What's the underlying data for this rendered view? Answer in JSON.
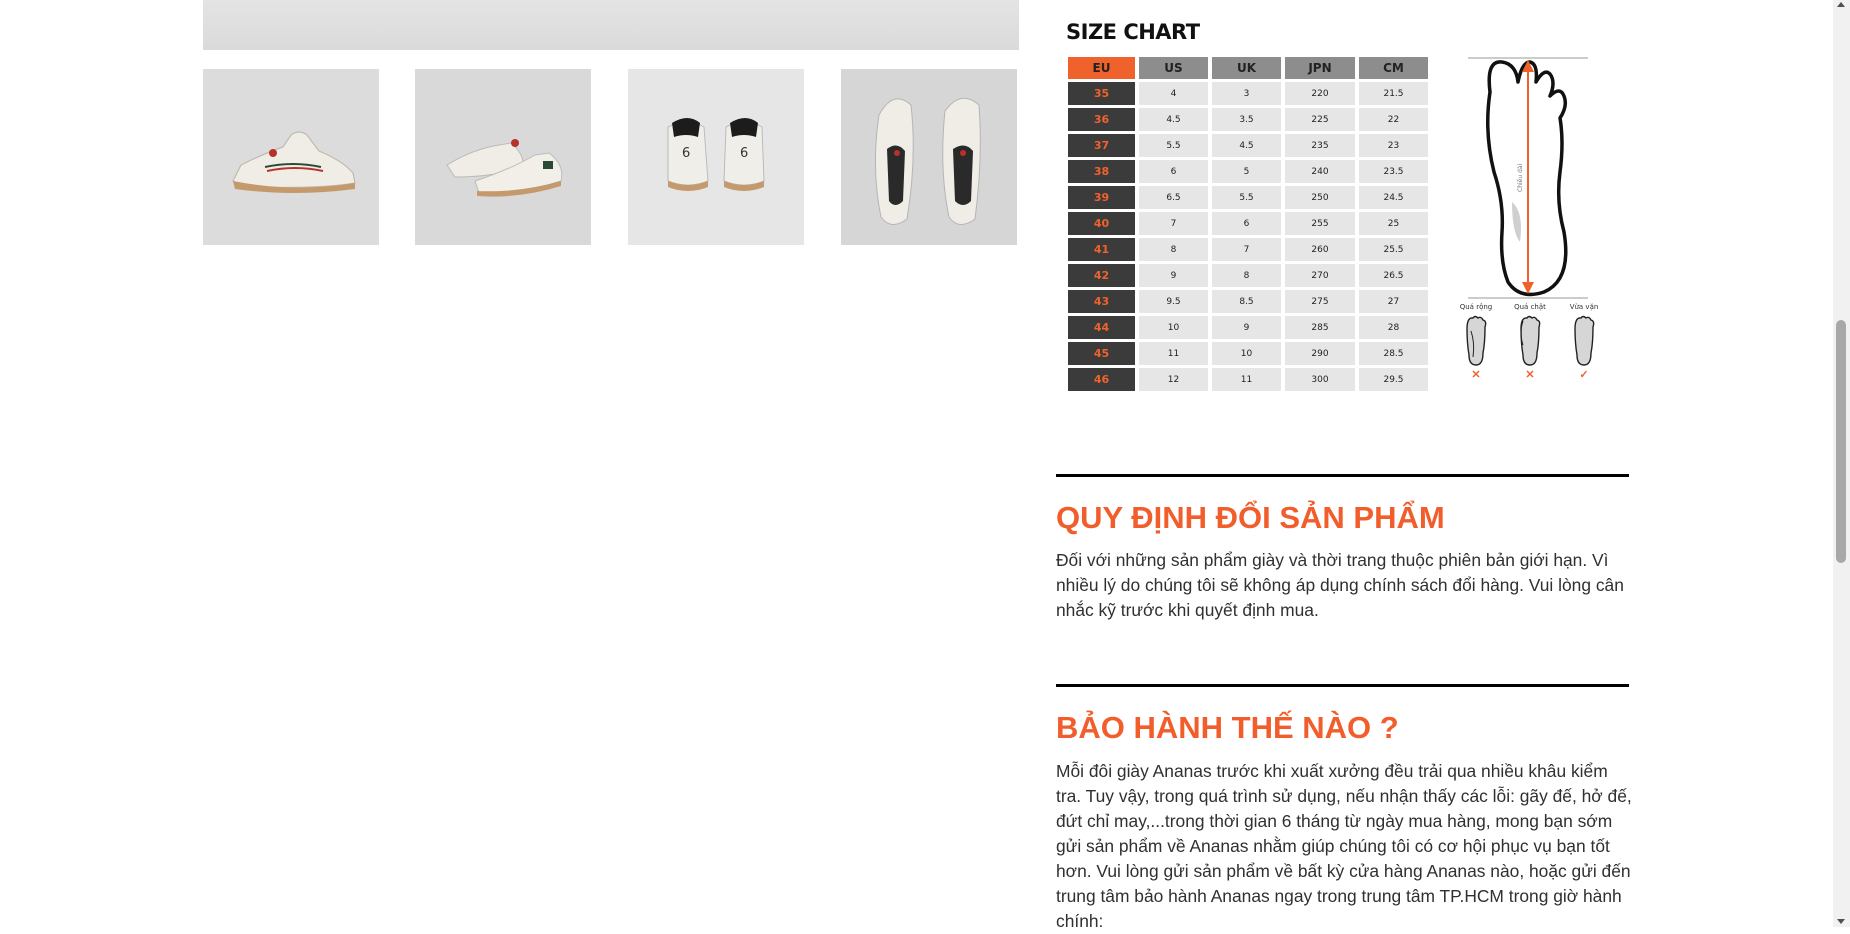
{
  "gallery": {
    "thumbnails": [
      {
        "name": "thumb-side-view",
        "alt_icon": "shoe-side-icon"
      },
      {
        "name": "thumb-angle-view",
        "alt_icon": "shoe-pair-icon"
      },
      {
        "name": "thumb-back-view",
        "alt_icon": "shoe-back-icon"
      },
      {
        "name": "thumb-top-view",
        "alt_icon": "shoe-top-icon"
      }
    ]
  },
  "size_chart": {
    "title": "SIZE CHART",
    "headers": [
      "EU",
      "US",
      "UK",
      "JPN",
      "CM"
    ],
    "rows": [
      [
        "35",
        "4",
        "3",
        "220",
        "21.5"
      ],
      [
        "36",
        "4.5",
        "3.5",
        "225",
        "22"
      ],
      [
        "37",
        "5.5",
        "4.5",
        "235",
        "23"
      ],
      [
        "38",
        "6",
        "5",
        "240",
        "23.5"
      ],
      [
        "39",
        "6.5",
        "5.5",
        "250",
        "24.5"
      ],
      [
        "40",
        "7",
        "6",
        "255",
        "25"
      ],
      [
        "41",
        "8",
        "7",
        "260",
        "25.5"
      ],
      [
        "42",
        "9",
        "8",
        "270",
        "26.5"
      ],
      [
        "43",
        "9.5",
        "8.5",
        "275",
        "27"
      ],
      [
        "44",
        "10",
        "9",
        "285",
        "28"
      ],
      [
        "45",
        "11",
        "10",
        "290",
        "28.5"
      ],
      [
        "46",
        "12",
        "11",
        "300",
        "29.5"
      ]
    ],
    "foot_measure_label": "Chiều dài",
    "fit_labels": [
      "Quá rộng",
      "Quá chật",
      "Vừa vặn"
    ],
    "fit_marks": [
      "✕",
      "✕",
      "✓"
    ],
    "accent_color": "#f0622c"
  },
  "sections": {
    "exchange": {
      "title": "QUY ĐỊNH ĐỔI SẢN PHẨM",
      "body": "Đối với những sản phẩm giày và thời trang thuộc phiên bản giới hạn. Vì nhiều lý do chúng tôi sẽ không áp dụng chính sách đổi hàng. Vui lòng cân nhắc kỹ trước khi quyết định mua."
    },
    "warranty": {
      "title": "BẢO HÀNH THẾ NÀO ?",
      "body": "Mỗi đôi giày Ananas trước khi xuất xưởng đều trải qua nhiều khâu kiểm tra. Tuy vậy, trong quá trình sử dụng, nếu nhận thấy các lỗi: gãy đế, hở đế, đứt chỉ may,...trong thời gian 6 tháng từ ngày mua hàng, mong bạn sớm gửi sản phẩm về Ananas nhằm giúp chúng tôi có cơ hội phục vụ bạn tốt hơn. Vui lòng gửi sản phẩm về bất kỳ cửa hàng Ananas nào, hoặc gửi đến trung tâm bảo hành Ananas ngay trong trung tâm TP.HCM trong giờ hành chính:"
    }
  },
  "colors": {
    "heading": "#f15e2c",
    "text": "#303030"
  }
}
